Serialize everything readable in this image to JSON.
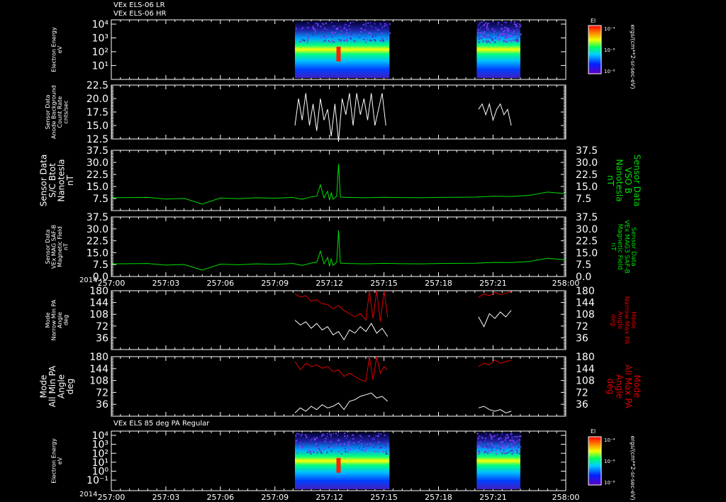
{
  "header": {
    "line1": "VEx ELS-06 LR",
    "line2": "VEx ELS-06 HR",
    "bottom_title": "VEx ELS 85 deg PA Regular"
  },
  "colors": {
    "background": "#000000",
    "frame": "#ffffff",
    "green": "#00e000",
    "red": "#e00000",
    "trace": "#ffffff"
  },
  "colorbar": {
    "label": "El",
    "units": "ergs/(cm**2-sr-sec-eV)",
    "ticks_top": [
      "10⁻⁴",
      "10⁻⁶",
      "10⁻⁸"
    ],
    "ticks_bottom": [
      "10⁻⁴",
      "10⁻⁶",
      "10⁻⁸"
    ]
  },
  "time_axis": {
    "year": "2014",
    "ticks": [
      "257:00",
      "257:03",
      "257:06",
      "257:09",
      "257:12",
      "257:15",
      "257:18",
      "257:21",
      "258:00"
    ]
  },
  "chart_data": [
    {
      "type": "heatmap",
      "ylabel": "Electron Energy\neV",
      "yticks": [
        "10⁴",
        "10³",
        "10²",
        "10¹"
      ],
      "ylog": true,
      "data_intervals": [
        [
          "257:10",
          "257:15"
        ],
        [
          "257:20",
          "257:21"
        ]
      ],
      "colorscale": "rainbow"
    },
    {
      "type": "line",
      "ylabel": "Sensor Data\nAnode Background\nCount Rate\ncnts/sec",
      "ylim": [
        12.5,
        22.5
      ],
      "yticks": [
        "22.5",
        "20.0",
        "17.5",
        "15.0",
        "12.5"
      ],
      "series": [
        {
          "color": "#ffffff",
          "segments": [
            {
              "x": [
                10.1,
                10.3,
                10.5,
                10.7,
                10.9,
                11.1,
                11.3,
                11.5,
                11.7,
                11.9,
                12.1,
                12.3,
                12.5,
                12.7,
                12.9,
                13.1,
                13.3,
                13.5,
                13.7,
                13.9,
                14.1,
                14.3,
                14.5,
                14.7,
                14.9,
                15.1
              ],
              "y": [
                15,
                20,
                16,
                21,
                15,
                19,
                14,
                20,
                16,
                18,
                13,
                19,
                12,
                20,
                17,
                21,
                15,
                21,
                17,
                20,
                16,
                21,
                15,
                18,
                21,
                15
              ]
            },
            {
              "x": [
                20.2,
                20.4,
                20.6,
                20.8,
                21.0,
                21.2,
                21.4,
                21.6,
                21.8,
                22.0
              ],
              "y": [
                18,
                19,
                17,
                19,
                16,
                18,
                19,
                17,
                18,
                15
              ]
            }
          ]
        }
      ]
    },
    {
      "type": "line",
      "ylabel": "Sensor Data\nS/C Btot\nNanotesla\nnT",
      "ylabel_right": "Sensor Data\nVSO B\nNanotesla\nnT",
      "ylim": [
        0,
        37.5
      ],
      "yticks": [
        "37.5",
        "30.0",
        "22.5",
        "15.0",
        "7.5"
      ],
      "series": [
        {
          "name": "",
          "color": "#00e000",
          "x": [
            0,
            2,
            3,
            4,
            5,
            6,
            7,
            8,
            9,
            10,
            10.5,
            11,
            11.3,
            11.5,
            11.7,
            11.9,
            12,
            12.1,
            12.2,
            12.4,
            12.5,
            12.6,
            13,
            14,
            15,
            16,
            17,
            18,
            19,
            20,
            21,
            22,
            23,
            24,
            25
          ],
          "y": [
            8,
            8.2,
            7.2,
            7.6,
            4,
            7.8,
            7.4,
            8,
            7.7,
            8.2,
            7,
            8.5,
            9,
            16,
            8,
            12,
            6.5,
            11,
            7,
            9,
            29,
            8.4,
            8.2,
            8,
            8.3,
            8.1,
            8,
            8.2,
            8.3,
            8.4,
            8.9,
            8.8,
            9.5,
            11.5,
            10.5
          ]
        }
      ]
    },
    {
      "type": "line",
      "ylabel": "Sensor Data\nVEx MAG SAF-B\nMagnetic Field\nnT",
      "ylabel_right": "Sensor Data\nVEx MAG3 SAF-B\nMagnetic Field\nnT",
      "ylim": [
        0,
        37.5
      ],
      "yticks": [
        "37.5",
        "30.0",
        "22.5",
        "15.0",
        "7.5",
        "0.0"
      ],
      "series": [
        {
          "name": "",
          "color": "#00e000",
          "x": [
            0,
            2,
            3,
            4,
            5,
            6,
            7,
            8,
            9,
            10,
            10.5,
            11,
            11.3,
            11.5,
            11.7,
            11.9,
            12,
            12.1,
            12.2,
            12.4,
            12.5,
            12.6,
            13,
            14,
            15,
            16,
            17,
            18,
            19,
            20,
            21,
            22,
            23,
            24,
            25
          ],
          "y": [
            8,
            8.2,
            7.2,
            7.6,
            4,
            7.8,
            7.4,
            8,
            7.7,
            8.2,
            7,
            8.5,
            9,
            16,
            8,
            12,
            6.5,
            11,
            7,
            9,
            29,
            8.4,
            8.2,
            8,
            8.3,
            8.1,
            8,
            8.2,
            8.3,
            8.4,
            8.9,
            8.8,
            9.5,
            11.5,
            10.5
          ]
        }
      ]
    },
    {
      "type": "line",
      "ylabel": "Mode\nNarrow Min PA\nAngle\ndeg",
      "ylabel_right": "Mode\nNarrow Max PA\nAngle\ndeg",
      "ylim": [
        0,
        180
      ],
      "yticks": [
        "180",
        "144",
        "108",
        "72",
        "36"
      ],
      "series": [
        {
          "name": "",
          "color": "#e00000",
          "segments": [
            {
              "x": [
                10.1,
                10.4,
                10.7,
                11.0,
                11.3,
                11.6,
                11.9,
                12.2,
                12.5,
                12.8,
                13.1,
                13.4,
                13.7,
                14.0,
                14.2,
                14.4,
                14.6,
                14.8,
                15.0,
                15.2
              ],
              "y": [
                170,
                160,
                165,
                148,
                152,
                140,
                138,
                125,
                135,
                120,
                110,
                100,
                110,
                90,
                180,
                95,
                180,
                85,
                180,
                100
              ]
            },
            {
              "x": [
                20.2,
                20.5,
                20.8,
                21.1,
                21.4,
                21.7,
                22.0
              ],
              "y": [
                160,
                170,
                165,
                175,
                168,
                172,
                178
              ]
            }
          ]
        },
        {
          "name": "",
          "color": "#ffffff",
          "segments": [
            {
              "x": [
                10.1,
                10.4,
                10.7,
                11.0,
                11.3,
                11.6,
                11.9,
                12.2,
                12.5,
                12.8,
                13.1,
                13.4,
                13.7,
                14.0,
                14.3,
                14.6,
                14.9,
                15.2
              ],
              "y": [
                90,
                75,
                85,
                65,
                80,
                60,
                70,
                45,
                55,
                30,
                60,
                50,
                70,
                55,
                80,
                50,
                65,
                40
              ]
            },
            {
              "x": [
                20.2,
                20.5,
                20.8,
                21.1,
                21.4,
                21.7,
                22.0
              ],
              "y": [
                100,
                70,
                110,
                95,
                115,
                100,
                120
              ]
            }
          ]
        }
      ]
    },
    {
      "type": "line",
      "ylabel": "Mode\nAll Min PA\nAngle\ndeg",
      "ylabel_right": "Mode\nAll Max PA\nAngle\ndeg",
      "ylim": [
        0,
        180
      ],
      "yticks": [
        "180",
        "144",
        "108",
        "72",
        "36"
      ],
      "series": [
        {
          "name": "",
          "color": "#e00000",
          "segments": [
            {
              "x": [
                10.1,
                10.4,
                10.7,
                11.0,
                11.3,
                11.6,
                11.9,
                12.2,
                12.5,
                12.8,
                13.1,
                13.4,
                13.7,
                14.0,
                14.2,
                14.4,
                14.6,
                14.8,
                15.0,
                15.2
              ],
              "y": [
                165,
                140,
                160,
                150,
                155,
                145,
                150,
                135,
                140,
                120,
                130,
                120,
                110,
                105,
                180,
                110,
                180,
                130,
                150,
                140
              ]
            },
            {
              "x": [
                20.2,
                20.5,
                20.8,
                21.1,
                21.4,
                21.7,
                22.0
              ],
              "y": [
                150,
                160,
                155,
                170,
                160,
                165,
                170
              ]
            }
          ]
        },
        {
          "name": "",
          "color": "#ffffff",
          "segments": [
            {
              "x": [
                10.1,
                10.4,
                10.7,
                11.0,
                11.3,
                11.6,
                11.9,
                12.2,
                12.5,
                12.8,
                13.1,
                13.4,
                13.7,
                14.0,
                14.3,
                14.6,
                14.9,
                15.2
              ],
              "y": [
                10,
                25,
                15,
                30,
                20,
                35,
                25,
                30,
                40,
                20,
                45,
                50,
                60,
                65,
                70,
                55,
                60,
                45
              ]
            },
            {
              "x": [
                20.2,
                20.5,
                20.8,
                21.1,
                21.4,
                21.7,
                22.0
              ],
              "y": [
                25,
                30,
                20,
                15,
                20,
                10,
                15
              ]
            }
          ]
        }
      ]
    },
    {
      "type": "heatmap",
      "ylabel": "Electron Energy\neV",
      "yticks": [
        "10⁴",
        "10³",
        "10²",
        "10¹",
        "10⁰",
        "10⁻¹"
      ],
      "ylog": true,
      "data_intervals": [
        [
          "257:10",
          "257:15"
        ],
        [
          "257:20",
          "257:21"
        ]
      ],
      "colorscale": "rainbow"
    }
  ]
}
